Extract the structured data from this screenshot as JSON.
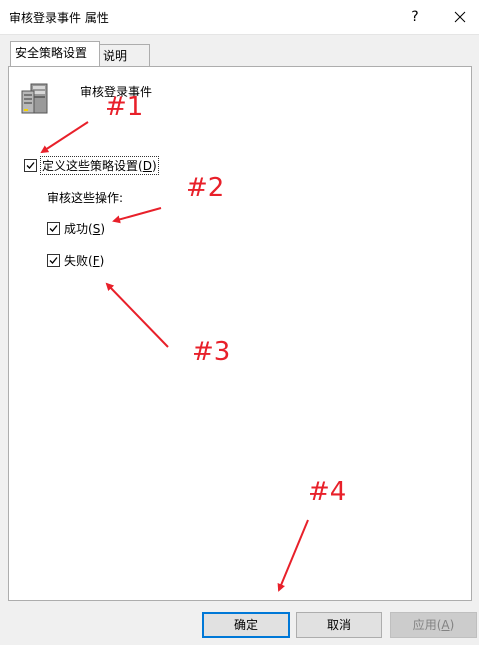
{
  "window": {
    "title": "审核登录事件 属性",
    "help_label": "?",
    "close_icon": "close-icon"
  },
  "tabs": [
    {
      "label": "安全策略设置",
      "active": true
    },
    {
      "label": "说明",
      "active": false
    }
  ],
  "panel": {
    "icon": "server-icon",
    "event_title": "审核登录事件",
    "define_checkbox": {
      "label": "定义这些策略设置",
      "accel": "D",
      "checked": true
    },
    "audit_label": "审核这些操作:",
    "success_checkbox": {
      "label": "成功",
      "accel": "S",
      "checked": true
    },
    "failure_checkbox": {
      "label": "失败",
      "accel": "F",
      "checked": true
    }
  },
  "annotations": {
    "labels": [
      "#1",
      "#2",
      "#3",
      "#4"
    ],
    "color": "#e8202a"
  },
  "buttons": {
    "ok": "确定",
    "cancel": "取消",
    "apply_label": "应用",
    "apply_accel": "A",
    "apply_enabled": false
  }
}
